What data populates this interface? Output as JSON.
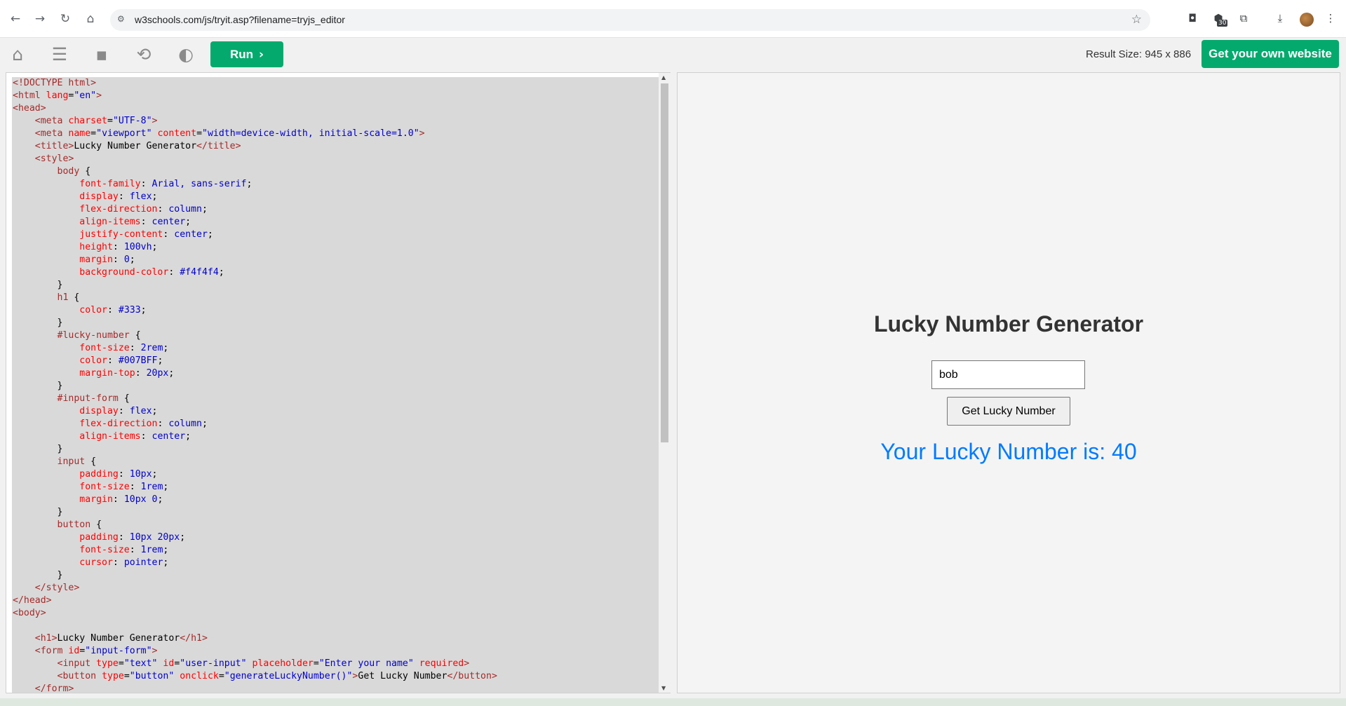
{
  "browser": {
    "url": "w3schools.com/js/tryit.asp?filename=tryjs_editor",
    "extension_badge": "30"
  },
  "toolbar": {
    "run_label": "Run",
    "result_size": "Result Size: 945 x 886",
    "own_website_label": "Get your own website"
  },
  "editor": {
    "lines": [
      [
        [
          "tag",
          "<!DOCTYPE html>"
        ]
      ],
      [
        [
          "tag",
          "<html "
        ],
        [
          "attr",
          "lang"
        ],
        [
          "punc",
          "="
        ],
        [
          "val",
          "\"en\""
        ],
        [
          "tag",
          ">"
        ]
      ],
      [
        [
          "tag",
          "<head>"
        ]
      ],
      [
        [
          "text",
          "    "
        ],
        [
          "tag",
          "<meta "
        ],
        [
          "attr",
          "charset"
        ],
        [
          "punc",
          "="
        ],
        [
          "val",
          "\"UTF-8\""
        ],
        [
          "tag",
          ">"
        ]
      ],
      [
        [
          "text",
          "    "
        ],
        [
          "tag",
          "<meta "
        ],
        [
          "attr",
          "name"
        ],
        [
          "punc",
          "="
        ],
        [
          "val",
          "\"viewport\""
        ],
        [
          "text",
          " "
        ],
        [
          "attr",
          "content"
        ],
        [
          "punc",
          "="
        ],
        [
          "val",
          "\"width=device-width, initial-scale=1.0\""
        ],
        [
          "tag",
          ">"
        ]
      ],
      [
        [
          "text",
          "    "
        ],
        [
          "tag",
          "<title>"
        ],
        [
          "text",
          "Lucky Number Generator"
        ],
        [
          "tag",
          "</title>"
        ]
      ],
      [
        [
          "text",
          "    "
        ],
        [
          "tag",
          "<style>"
        ]
      ],
      [
        [
          "text",
          "        "
        ],
        [
          "sel",
          "body"
        ],
        [
          "punc",
          " {"
        ]
      ],
      [
        [
          "text",
          "            "
        ],
        [
          "prop",
          "font-family"
        ],
        [
          "punc",
          ": "
        ],
        [
          "cssval",
          "Arial, sans-serif"
        ],
        [
          "punc",
          ";"
        ]
      ],
      [
        [
          "text",
          "            "
        ],
        [
          "prop",
          "display"
        ],
        [
          "punc",
          ": "
        ],
        [
          "cssval",
          "flex"
        ],
        [
          "punc",
          ";"
        ]
      ],
      [
        [
          "text",
          "            "
        ],
        [
          "prop",
          "flex-direction"
        ],
        [
          "punc",
          ": "
        ],
        [
          "cssval",
          "column"
        ],
        [
          "punc",
          ";"
        ]
      ],
      [
        [
          "text",
          "            "
        ],
        [
          "prop",
          "align-items"
        ],
        [
          "punc",
          ": "
        ],
        [
          "cssval",
          "center"
        ],
        [
          "punc",
          ";"
        ]
      ],
      [
        [
          "text",
          "            "
        ],
        [
          "prop",
          "justify-content"
        ],
        [
          "punc",
          ": "
        ],
        [
          "cssval",
          "center"
        ],
        [
          "punc",
          ";"
        ]
      ],
      [
        [
          "text",
          "            "
        ],
        [
          "prop",
          "height"
        ],
        [
          "punc",
          ": "
        ],
        [
          "cssval",
          "100vh"
        ],
        [
          "punc",
          ";"
        ]
      ],
      [
        [
          "text",
          "            "
        ],
        [
          "prop",
          "margin"
        ],
        [
          "punc",
          ": "
        ],
        [
          "cssval",
          "0"
        ],
        [
          "punc",
          ";"
        ]
      ],
      [
        [
          "text",
          "            "
        ],
        [
          "prop",
          "background-color"
        ],
        [
          "punc",
          ": "
        ],
        [
          "cssval",
          "#f4f4f4"
        ],
        [
          "punc",
          ";"
        ]
      ],
      [
        [
          "text",
          "        "
        ],
        [
          "punc",
          "}"
        ]
      ],
      [
        [
          "text",
          "        "
        ],
        [
          "sel",
          "h1"
        ],
        [
          "punc",
          " {"
        ]
      ],
      [
        [
          "text",
          "            "
        ],
        [
          "prop",
          "color"
        ],
        [
          "punc",
          ": "
        ],
        [
          "cssval",
          "#333"
        ],
        [
          "punc",
          ";"
        ]
      ],
      [
        [
          "text",
          "        "
        ],
        [
          "punc",
          "}"
        ]
      ],
      [
        [
          "text",
          "        "
        ],
        [
          "sel",
          "#lucky-number"
        ],
        [
          "punc",
          " {"
        ]
      ],
      [
        [
          "text",
          "            "
        ],
        [
          "prop",
          "font-size"
        ],
        [
          "punc",
          ": "
        ],
        [
          "cssval",
          "2rem"
        ],
        [
          "punc",
          ";"
        ]
      ],
      [
        [
          "text",
          "            "
        ],
        [
          "prop",
          "color"
        ],
        [
          "punc",
          ": "
        ],
        [
          "cssval",
          "#007BFF"
        ],
        [
          "punc",
          ";"
        ]
      ],
      [
        [
          "text",
          "            "
        ],
        [
          "prop",
          "margin-top"
        ],
        [
          "punc",
          ": "
        ],
        [
          "cssval",
          "20px"
        ],
        [
          "punc",
          ";"
        ]
      ],
      [
        [
          "text",
          "        "
        ],
        [
          "punc",
          "}"
        ]
      ],
      [
        [
          "text",
          "        "
        ],
        [
          "sel",
          "#input-form"
        ],
        [
          "punc",
          " {"
        ]
      ],
      [
        [
          "text",
          "            "
        ],
        [
          "prop",
          "display"
        ],
        [
          "punc",
          ": "
        ],
        [
          "cssval",
          "flex"
        ],
        [
          "punc",
          ";"
        ]
      ],
      [
        [
          "text",
          "            "
        ],
        [
          "prop",
          "flex-direction"
        ],
        [
          "punc",
          ": "
        ],
        [
          "cssval",
          "column"
        ],
        [
          "punc",
          ";"
        ]
      ],
      [
        [
          "text",
          "            "
        ],
        [
          "prop",
          "align-items"
        ],
        [
          "punc",
          ": "
        ],
        [
          "cssval",
          "center"
        ],
        [
          "punc",
          ";"
        ]
      ],
      [
        [
          "text",
          "        "
        ],
        [
          "punc",
          "}"
        ]
      ],
      [
        [
          "text",
          "        "
        ],
        [
          "sel",
          "input"
        ],
        [
          "punc",
          " {"
        ]
      ],
      [
        [
          "text",
          "            "
        ],
        [
          "prop",
          "padding"
        ],
        [
          "punc",
          ": "
        ],
        [
          "cssval",
          "10px"
        ],
        [
          "punc",
          ";"
        ]
      ],
      [
        [
          "text",
          "            "
        ],
        [
          "prop",
          "font-size"
        ],
        [
          "punc",
          ": "
        ],
        [
          "cssval",
          "1rem"
        ],
        [
          "punc",
          ";"
        ]
      ],
      [
        [
          "text",
          "            "
        ],
        [
          "prop",
          "margin"
        ],
        [
          "punc",
          ": "
        ],
        [
          "cssval",
          "10px 0"
        ],
        [
          "punc",
          ";"
        ]
      ],
      [
        [
          "text",
          "        "
        ],
        [
          "punc",
          "}"
        ]
      ],
      [
        [
          "text",
          "        "
        ],
        [
          "sel",
          "button"
        ],
        [
          "punc",
          " {"
        ]
      ],
      [
        [
          "text",
          "            "
        ],
        [
          "prop",
          "padding"
        ],
        [
          "punc",
          ": "
        ],
        [
          "cssval",
          "10px 20px"
        ],
        [
          "punc",
          ";"
        ]
      ],
      [
        [
          "text",
          "            "
        ],
        [
          "prop",
          "font-size"
        ],
        [
          "punc",
          ": "
        ],
        [
          "cssval",
          "1rem"
        ],
        [
          "punc",
          ";"
        ]
      ],
      [
        [
          "text",
          "            "
        ],
        [
          "prop",
          "cursor"
        ],
        [
          "punc",
          ": "
        ],
        [
          "cssval",
          "pointer"
        ],
        [
          "punc",
          ";"
        ]
      ],
      [
        [
          "text",
          "        "
        ],
        [
          "punc",
          "}"
        ]
      ],
      [
        [
          "text",
          "    "
        ],
        [
          "tag",
          "</style>"
        ]
      ],
      [
        [
          "tag",
          "</head>"
        ]
      ],
      [
        [
          "tag",
          "<body>"
        ]
      ],
      [
        [
          "text",
          ""
        ]
      ],
      [
        [
          "text",
          "    "
        ],
        [
          "tag",
          "<h1>"
        ],
        [
          "text",
          "Lucky Number Generator"
        ],
        [
          "tag",
          "</h1>"
        ]
      ],
      [
        [
          "text",
          "    "
        ],
        [
          "tag",
          "<form "
        ],
        [
          "attr",
          "id"
        ],
        [
          "punc",
          "="
        ],
        [
          "val",
          "\"input-form\""
        ],
        [
          "tag",
          ">"
        ]
      ],
      [
        [
          "text",
          "        "
        ],
        [
          "tag",
          "<input "
        ],
        [
          "attr",
          "type"
        ],
        [
          "punc",
          "="
        ],
        [
          "val",
          "\"text\""
        ],
        [
          "text",
          " "
        ],
        [
          "attr",
          "id"
        ],
        [
          "punc",
          "="
        ],
        [
          "val",
          "\"user-input\""
        ],
        [
          "text",
          " "
        ],
        [
          "attr",
          "placeholder"
        ],
        [
          "punc",
          "="
        ],
        [
          "val",
          "\"Enter your name\""
        ],
        [
          "text",
          " "
        ],
        [
          "attr",
          "required"
        ],
        [
          "tag",
          ">"
        ]
      ],
      [
        [
          "text",
          "        "
        ],
        [
          "tag",
          "<button "
        ],
        [
          "attr",
          "type"
        ],
        [
          "punc",
          "="
        ],
        [
          "val",
          "\"button\""
        ],
        [
          "text",
          " "
        ],
        [
          "attr",
          "onclick"
        ],
        [
          "punc",
          "="
        ],
        [
          "val",
          "\"generateLuckyNumber()\""
        ],
        [
          "tag",
          ">"
        ],
        [
          "text",
          "Get Lucky Number"
        ],
        [
          "tag",
          "</button>"
        ]
      ],
      [
        [
          "text",
          "    "
        ],
        [
          "tag",
          "</form>"
        ]
      ]
    ]
  },
  "result": {
    "title": "Lucky Number Generator",
    "input_value": "bob",
    "button_label": "Get Lucky Number",
    "lucky_text": "Your Lucky Number is: 40"
  },
  "colors": {
    "accent": "#04aa6d",
    "lucky_blue": "#007bff"
  }
}
